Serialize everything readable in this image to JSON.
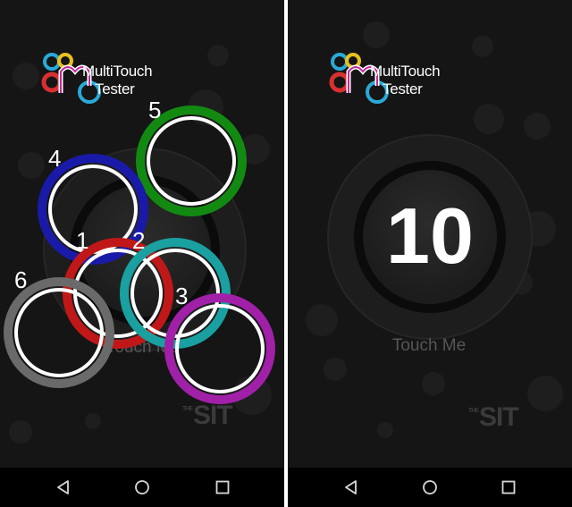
{
  "app": {
    "logo_line1": "MultiTouch",
    "logo_line2": "Tester",
    "watermark": "SIT",
    "watermark_small": "THE"
  },
  "left_screen": {
    "touch_me": "Touch Me",
    "touch_points": [
      {
        "label": "1",
        "color": "#c01818"
      },
      {
        "label": "2",
        "color": "#1aa0a0"
      },
      {
        "label": "3",
        "color": "#a020a8"
      },
      {
        "label": "4",
        "color": "#1a1aa8"
      },
      {
        "label": "5",
        "color": "#128a12"
      },
      {
        "label": "6",
        "color": "#6a6a6a"
      }
    ]
  },
  "right_screen": {
    "count": "10",
    "touch_me": "Touch Me"
  },
  "nav": {
    "back_icon": "triangle-back-icon",
    "home_icon": "circle-home-icon",
    "recent_icon": "square-recents-icon"
  },
  "colors": {
    "background": "#151515",
    "logo_red": "#d83030",
    "logo_yellow": "#e8c020",
    "logo_blue": "#2aa8d8",
    "logo_magenta": "#c02898"
  }
}
